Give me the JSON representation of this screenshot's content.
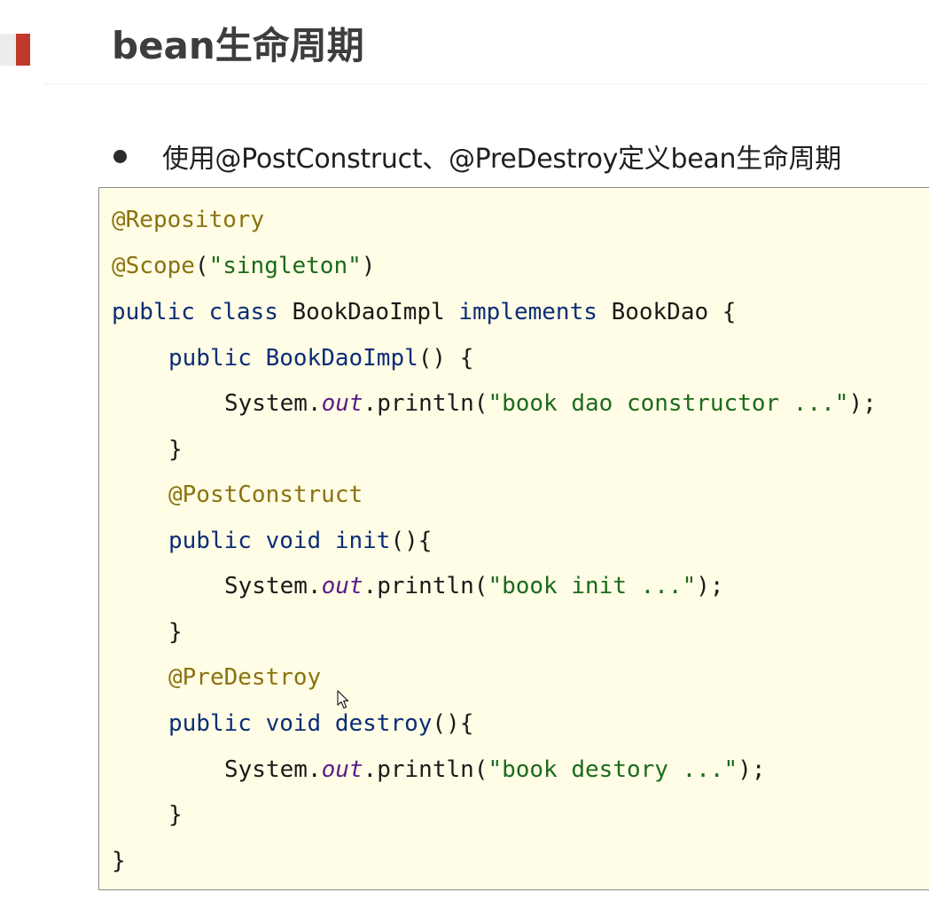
{
  "header": {
    "title": "bean生命周期"
  },
  "bullet": {
    "text": "使用@PostConstruct、@PreDestroy定义bean生命周期"
  },
  "code": {
    "line1": {
      "annotation": "@Repository"
    },
    "line2": {
      "annotation": "@Scope",
      "open": "(",
      "string": "\"singleton\"",
      "close": ")"
    },
    "line3": {
      "kw1": "public",
      "kw2": "class",
      "name": "BookDaoImpl",
      "kw3": "implements",
      "iface": "BookDao",
      "brace": "{"
    },
    "line4": {
      "kw": "public",
      "ctor": "BookDaoImpl",
      "rest": "() {"
    },
    "line5": {
      "obj": "System.",
      "field": "out",
      "call": ".println(",
      "string": "\"book dao constructor ...\"",
      "end": ");"
    },
    "line6": {
      "brace": "}"
    },
    "line7": {
      "annotation": "@PostConstruct"
    },
    "line8": {
      "kw": "public void",
      "name": "init",
      "rest": "(){"
    },
    "line9": {
      "obj": "System.",
      "field": "out",
      "call": ".println(",
      "string": "\"book init ...\"",
      "end": ");"
    },
    "line10": {
      "brace": "}"
    },
    "line11": {
      "annotation": "@PreDestroy"
    },
    "line12": {
      "kw": "public void",
      "name": "destroy",
      "rest": "(){"
    },
    "line13": {
      "obj": "System.",
      "field": "out",
      "call": ".println(",
      "string": "\"book destory ...\"",
      "end": ");"
    },
    "line14": {
      "brace": "}"
    },
    "line15": {
      "brace": "}"
    }
  },
  "colors": {
    "accent": "#c0392b",
    "code_background": "#fffde5",
    "keyword": "#0b2d78",
    "annotation": "#8b7211",
    "string": "#1c6a1c",
    "field": "#5b1a87"
  },
  "icons": {
    "cursor": "mouse-pointer-icon"
  }
}
